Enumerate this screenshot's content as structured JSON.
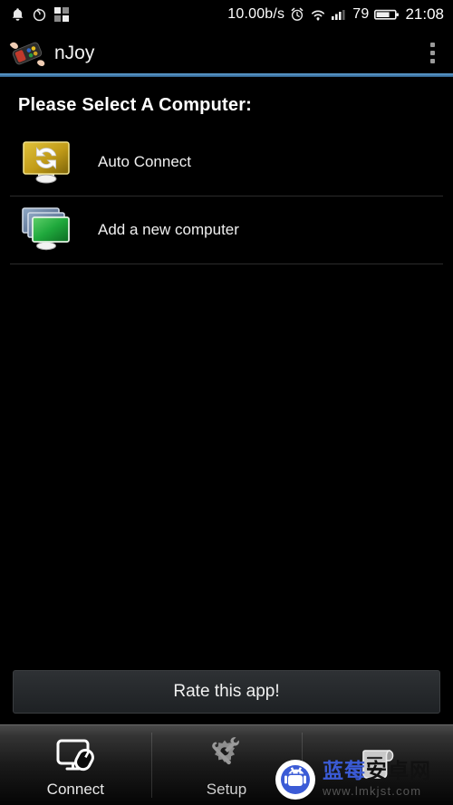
{
  "statusbar": {
    "icons_left": [
      "notification-bell-icon",
      "netease-music-icon",
      "app-grid-icon"
    ],
    "network_speed": "10.00b/s",
    "alarm_icon": "alarm-clock-icon",
    "wifi_icon": "wifi-icon",
    "signal_icon": "cellular-signal-icon",
    "battery_percent": "79",
    "battery_icon": "battery-icon",
    "time": "21:08"
  },
  "actionbar": {
    "logo_icon": "gamepad-in-hand-logo",
    "title": "nJoy",
    "overflow_icon": "overflow-menu-icon"
  },
  "main": {
    "page_title": "Please Select A Computer:",
    "items": [
      {
        "label": "Auto Connect",
        "icon": "auto-connect-monitor-icon"
      },
      {
        "label": "Add a new computer",
        "icon": "add-computer-monitors-icon"
      }
    ],
    "rate_button": "Rate this app!"
  },
  "tabbar": {
    "tabs": [
      {
        "label": "Connect",
        "icon": "monitor-mouse-icon",
        "active": true
      },
      {
        "label": "Setup",
        "icon": "gear-wrench-icon",
        "active": false
      },
      {
        "label": "",
        "icon": "scroll-document-icon",
        "active": false
      }
    ]
  },
  "watermark": {
    "site_name": "蓝莓安卓网",
    "site_name_blue": "蓝莓",
    "site_name_dark": "安卓网",
    "url": "www.lmkjst.com",
    "logo_icon": "android-robot-icon"
  },
  "colors": {
    "accent_blue": "#4a86b8",
    "auto_connect_gold": "#c9a227",
    "add_computer_green": "#21a73e",
    "background": "#000000",
    "watermark_blue": "#3b5bd6"
  }
}
